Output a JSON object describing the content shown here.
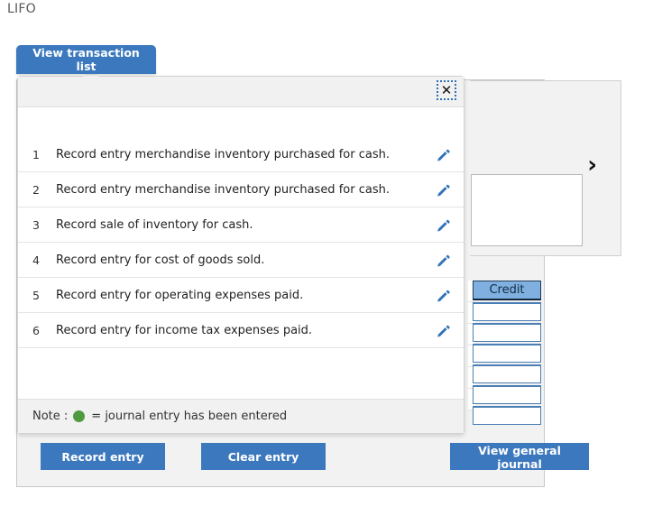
{
  "page": {
    "title": "LIFO"
  },
  "toolbar": {
    "view_transaction_list_label": "View transaction list"
  },
  "popup": {
    "close_icon_glyph": "✕",
    "transactions": [
      {
        "num": "1",
        "text": "Record entry merchandise inventory purchased for cash."
      },
      {
        "num": "2",
        "text": "Record entry merchandise inventory purchased for cash."
      },
      {
        "num": "3",
        "text": "Record sale of inventory for cash."
      },
      {
        "num": "4",
        "text": "Record entry for cost of goods sold."
      },
      {
        "num": "5",
        "text": "Record entry for operating expenses paid."
      },
      {
        "num": "6",
        "text": "Record entry for income tax expenses paid."
      }
    ],
    "note_prefix": "Note :",
    "note_text": "= journal entry has been entered",
    "note_dot_color": "#4f9a41"
  },
  "entry_panel": {
    "next_chevron_glyph": "›",
    "memo_value": ""
  },
  "ledger": {
    "column_header": "Credit",
    "cells": [
      "",
      "",
      "",
      "",
      "",
      ""
    ]
  },
  "actions": {
    "record_entry_label": "Record entry",
    "clear_entry_label": "Clear entry",
    "view_general_journal_label": "View general journal"
  },
  "colors": {
    "primary_blue": "#3c78bd",
    "header_blue": "#7fb0e0",
    "note_green": "#4f9a41",
    "panel_grey": "#f2f2f2"
  }
}
